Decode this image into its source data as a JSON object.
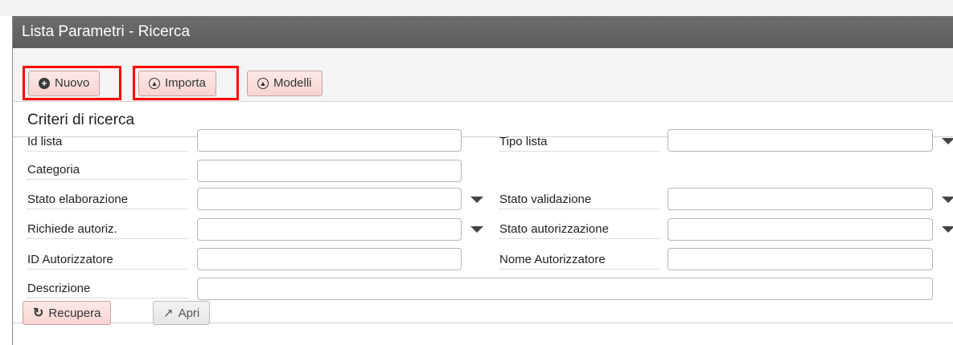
{
  "window": {
    "title": "Lista Parametri - Ricerca"
  },
  "toolbar": {
    "nuovo_label": "Nuovo",
    "importa_label": "Importa",
    "modelli_label": "Modelli"
  },
  "section": {
    "title": "Criteri di ricerca"
  },
  "fields": {
    "id_lista": {
      "label": "Id lista",
      "value": ""
    },
    "tipo_lista": {
      "label": "Tipo lista",
      "value": ""
    },
    "categoria": {
      "label": "Categoria",
      "value": ""
    },
    "stato_elaborazione": {
      "label": "Stato elaborazione",
      "value": ""
    },
    "stato_validazione": {
      "label": "Stato validazione",
      "value": ""
    },
    "richiede_autoriz": {
      "label": "Richiede autoriz.",
      "value": ""
    },
    "stato_autorizzazione": {
      "label": "Stato autorizzazione",
      "value": ""
    },
    "id_autorizzatore": {
      "label": "ID Autorizzatore",
      "value": ""
    },
    "nome_autorizzatore": {
      "label": "Nome Autorizzatore",
      "value": ""
    },
    "descrizione": {
      "label": "Descrizione",
      "value": ""
    }
  },
  "footer": {
    "recupera_label": "Recupera",
    "apri_label": "Apri"
  },
  "icons": {
    "nuovo": "plus-circle-icon",
    "importa": "upload-circle-icon",
    "modelli": "upload-circle-icon",
    "recupera": "refresh-icon",
    "apri": "external-link-icon"
  },
  "colors": {
    "highlight": "#ff0000",
    "button_bg": "#f7d4d0",
    "titlebar": "#636363"
  }
}
